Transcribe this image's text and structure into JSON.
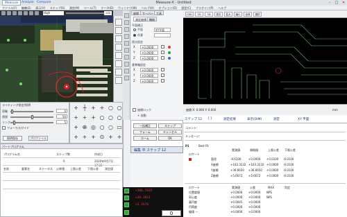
{
  "titlebar": {
    "title": "Measure-X - Untitled",
    "tabs": [
      "Measure",
      "Analyze",
      "Compare"
    ],
    "win_buttons": [
      "–",
      "□",
      "✕"
    ]
  },
  "menubar": {
    "items": [
      "ファイル(F)",
      "編集(E)",
      "表示(V)",
      "ステップ(S)",
      "測定(M)",
      "ツール(T)",
      "データ(D)",
      "ウィンドウ(W)",
      "ヘルプ(H)",
      "オプション(O)",
      "設定(C)",
      "プラグイン(P)",
      "ヘルプ"
    ]
  },
  "camera_toolbar": {
    "zoom_label": "High",
    "view_label": "100"
  },
  "light": {
    "title": "ライティング設定/照明",
    "rows": [
      {
        "label": "同軸",
        "value": "0"
      },
      {
        "label": "透過",
        "value": "50"
      },
      {
        "label": "リング",
        "value": "5"
      }
    ],
    "option_label": "フォーカスガイド",
    "buttons": [
      "照明保存",
      "プロファイル"
    ]
  },
  "element_tools": {
    "glyphs": [
      "+",
      "┼",
      "+",
      "+",
      "○",
      "○",
      "+",
      "+",
      "+",
      "○",
      "○",
      "○",
      "+",
      "⊕",
      "◎",
      "○",
      "○",
      "▭",
      "+",
      "+",
      "+",
      "⊙",
      "+",
      "+"
    ]
  },
  "program": {
    "header": "パートプログラム",
    "cols": [
      "プログラム名",
      "ステップ数",
      "作成日"
    ],
    "row": {
      "name": "",
      "steps": "0",
      "date": "2020年9月7日 17:22"
    },
    "cols2": [
      "名前",
      "要素名",
      "ステータス",
      "公称値",
      "上限公差",
      "下限公差",
      "測定値"
    ]
  },
  "coord": {
    "tabs": [
      "座標",
      "サーバー",
      "工具"
    ],
    "subtabs": [
      "測定座標",
      "機械"
    ],
    "sec1": "平面補正",
    "radio1": "平面",
    "radio1_value": "XY平面",
    "radio2": "任意",
    "sec2": "原点設定",
    "origin": [
      "X",
      "+0.0000",
      "Y",
      "+0.0000",
      "Z",
      "+0.0000"
    ],
    "sec3": "基準軸設定",
    "axis": [
      "X",
      "+0.0000",
      "Y",
      "+0.0000",
      "Z",
      "+0.0000"
    ],
    "check1": "座標ロック",
    "check2": "+ 自動"
  },
  "step": {
    "buttons": [
      [
        "一括補正",
        "ステップ"
      ],
      [
        "フォーム",
        "キャンセル"
      ],
      [
        "ホーム",
        "OK"
      ]
    ],
    "bar": "編集 中 ステップ 12"
  },
  "dro": {
    "x": "+106.7622",
    "y": "+30.3021",
    "z": "+3.2470",
    "count": "0"
  },
  "cad": {
    "toolbar": [
      "CAD",
      "2D",
      "3D",
      "表示",
      "拡大",
      "縮小",
      "全体",
      "選択"
    ],
    "status_left": "座標 X: 0.000 Y: 0.000",
    "status_right": "mm"
  },
  "result": {
    "header": [
      "ステップ 12",
      "[ ]",
      "測定結果",
      "表示(DIM)",
      "測定",
      "XY 平面"
    ],
    "comment_label": "コメント:",
    "message_label": "メッセージ:",
    "bf_id": "P1",
    "bf_title": "Best Fit",
    "bf_head": [
      "実測値",
      "規格値",
      "上限公差",
      "下限公差"
    ],
    "bf_section": "ロケート",
    "bf_rows": [
      {
        "name": "直径",
        "v": [
          "-0.6100",
          "+0.0000",
          "+0.0100",
          "-0.0100"
        ]
      },
      {
        "name": "X座標",
        "v": [
          "+103.3232",
          "+103.3232",
          "+0.0000",
          "-0.0100"
        ]
      },
      {
        "name": "Y座標",
        "v": [
          "+36.6650",
          "+36.6650",
          "+0.0000",
          "-0.0100"
        ]
      },
      {
        "name": "Z座標",
        "v": [
          "+5.6672",
          "+5.6672",
          "+0.0000",
          "-0.0100"
        ]
      }
    ],
    "sec2_head": [
      "実測値",
      "公差",
      "MAX",
      "判定"
    ],
    "sec2_section": "ロケート",
    "sec2_rows": [
      {
        "name": "位置度値",
        "v": [
          "+0.0000",
          "+0.0000",
          "NPS",
          ""
        ]
      },
      {
        "name": "同心度",
        "v": [
          "+0.0000",
          "+0.0000",
          "NPS",
          ""
        ]
      },
      {
        "name": "真円度",
        "v": [
          "+0.0045",
          "+0.0000",
          "",
          ""
        ]
      },
      {
        "name": "円筒度",
        "v": [
          "+0.0000",
          "+0.0000",
          "",
          ""
        ]
      },
      {
        "name": "幅値 −",
        "v": [
          "+0.0000",
          "+0.0000",
          "",
          ""
        ]
      }
    ]
  }
}
